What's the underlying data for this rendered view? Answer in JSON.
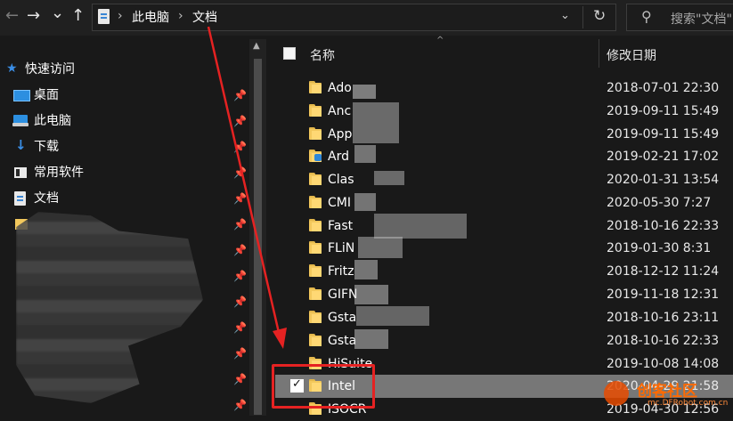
{
  "toolbar": {
    "back": "←",
    "forward": "→",
    "recent": "⌄",
    "up": "↑",
    "breadcrumbs": [
      "此电脑",
      "文档"
    ],
    "crumb_sep": "›",
    "dropdown": "⌄",
    "refresh": "↻",
    "search_icon": "⚲",
    "search_placeholder": "搜索\"文档\""
  },
  "sidebar": {
    "items": [
      {
        "label": "快速访问",
        "icon": "star-icon",
        "pinned": false
      },
      {
        "label": "桌面",
        "icon": "desktop-icon",
        "pinned": true
      },
      {
        "label": "此电脑",
        "icon": "computer-icon",
        "pinned": true
      },
      {
        "label": "下载",
        "icon": "download-icon",
        "pinned": true
      },
      {
        "label": "常用软件",
        "icon": "folder-icon",
        "pinned": true
      },
      {
        "label": "文档",
        "icon": "document-icon",
        "pinned": true
      }
    ],
    "pin_glyph": "📌",
    "scroll_up": "▲"
  },
  "files": {
    "header": {
      "name": "名称",
      "date": "修改日期",
      "sort": "^"
    },
    "rows": [
      {
        "name": "Ado",
        "date": "2018-07-01 22:30",
        "icon": "folder-icon"
      },
      {
        "name": "Anc",
        "date": "2019-09-11 15:49",
        "icon": "folder-icon"
      },
      {
        "name": "App",
        "date": "2019-09-11 15:49",
        "icon": "folder-icon"
      },
      {
        "name": "Ard",
        "date": "2019-02-21 17:02",
        "icon": "special-folder-icon"
      },
      {
        "name": "Clas",
        "date": "2020-01-31 13:54",
        "icon": "folder-icon"
      },
      {
        "name": "CMI",
        "date": "2020-05-30 7:27",
        "icon": "folder-icon"
      },
      {
        "name": "Fast",
        "date": "2018-10-16 22:33",
        "icon": "folder-icon"
      },
      {
        "name": "FLiN",
        "date": "2019-01-30 8:31",
        "icon": "folder-icon"
      },
      {
        "name": "Fritz",
        "date": "2018-12-12 11:24",
        "icon": "folder-icon"
      },
      {
        "name": "GIFN",
        "date": "2019-11-18 12:31",
        "icon": "folder-icon"
      },
      {
        "name": "Gsta",
        "date": "2018-10-16 23:11",
        "icon": "folder-icon"
      },
      {
        "name": "Gsta",
        "date": "2018-10-16 22:33",
        "icon": "folder-icon"
      },
      {
        "name": "HiSuite",
        "date": "2019-10-08 14:08",
        "icon": "folder-icon"
      },
      {
        "name": "Intel",
        "date": "2020-04-29 21:58",
        "icon": "folder-icon",
        "selected": true
      },
      {
        "name": "ISOCR",
        "date": "2019-04-30 12:56",
        "icon": "folder-icon"
      }
    ]
  },
  "watermark": {
    "title": "创客社区",
    "url": "mc.DFRobot.com.cn"
  },
  "colors": {
    "annotation": "#e52222",
    "selected_row": "#777777",
    "folder": "#f3c85c"
  }
}
